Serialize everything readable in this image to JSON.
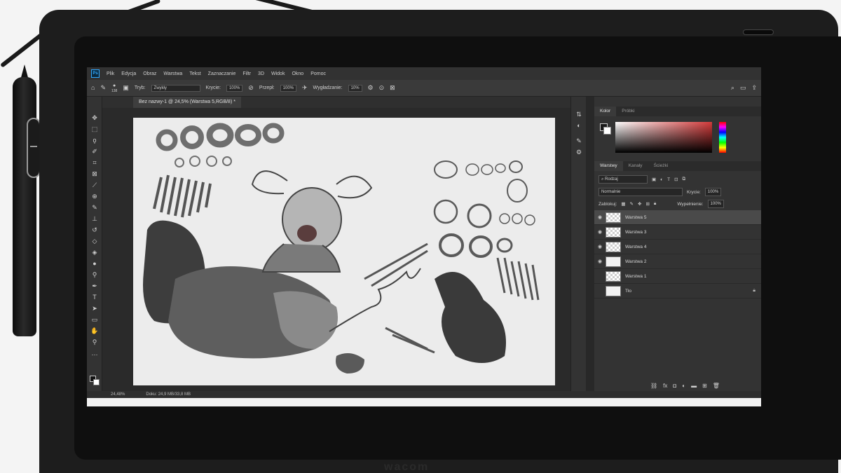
{
  "menubar": {
    "logo": "Ps",
    "items": [
      "Plik",
      "Edycja",
      "Obraz",
      "Warstwa",
      "Tekst",
      "Zaznaczanie",
      "Filtr",
      "3D",
      "Widok",
      "Okno",
      "Pomoc"
    ]
  },
  "options": {
    "brush_size": "138",
    "mode_label": "Tryb:",
    "mode_value": "Zwykły",
    "opacity_label": "Krycie:",
    "opacity_value": "100%",
    "flow_label": "Przepł:",
    "flow_value": "100%",
    "smoothing_label": "Wygładzanie:",
    "smoothing_value": "10%"
  },
  "document": {
    "tab_title": "Bez nazwy-1 @ 24,5% (Warstwa 5,RGB/8) *"
  },
  "color_panel": {
    "tabs": [
      "Kolor",
      "Próbki"
    ],
    "active": "Kolor"
  },
  "layers_panel": {
    "tabs": [
      "Warstwy",
      "Kanały",
      "Ścieżki"
    ],
    "filter_value": "Rodzaj",
    "blend_mode": "Normalnie",
    "opacity_label": "Krycie:",
    "opacity_value": "100%",
    "lock_label": "Zablokuj:",
    "fill_label": "Wypełnienie:",
    "fill_value": "100%",
    "layers": [
      {
        "name": "Warstwa 5",
        "visible": true,
        "selected": true
      },
      {
        "name": "Warstwa 3",
        "visible": true,
        "selected": false
      },
      {
        "name": "Warstwa 4",
        "visible": true,
        "selected": false
      },
      {
        "name": "Warstwa 2",
        "visible": true,
        "selected": false
      },
      {
        "name": "Warstwa 1",
        "visible": false,
        "selected": false
      },
      {
        "name": "Tło",
        "visible": false,
        "selected": false,
        "locked": true
      }
    ]
  },
  "status": {
    "zoom": "24,48%",
    "doc_size": "Doku: 24,9 MB/33,8 MB"
  },
  "device": {
    "brand": "wacom"
  },
  "colors": {
    "ui_dark": "#282828",
    "panel": "#333333",
    "ps_blue": "#31a8ff",
    "canvas": "#ececec"
  }
}
